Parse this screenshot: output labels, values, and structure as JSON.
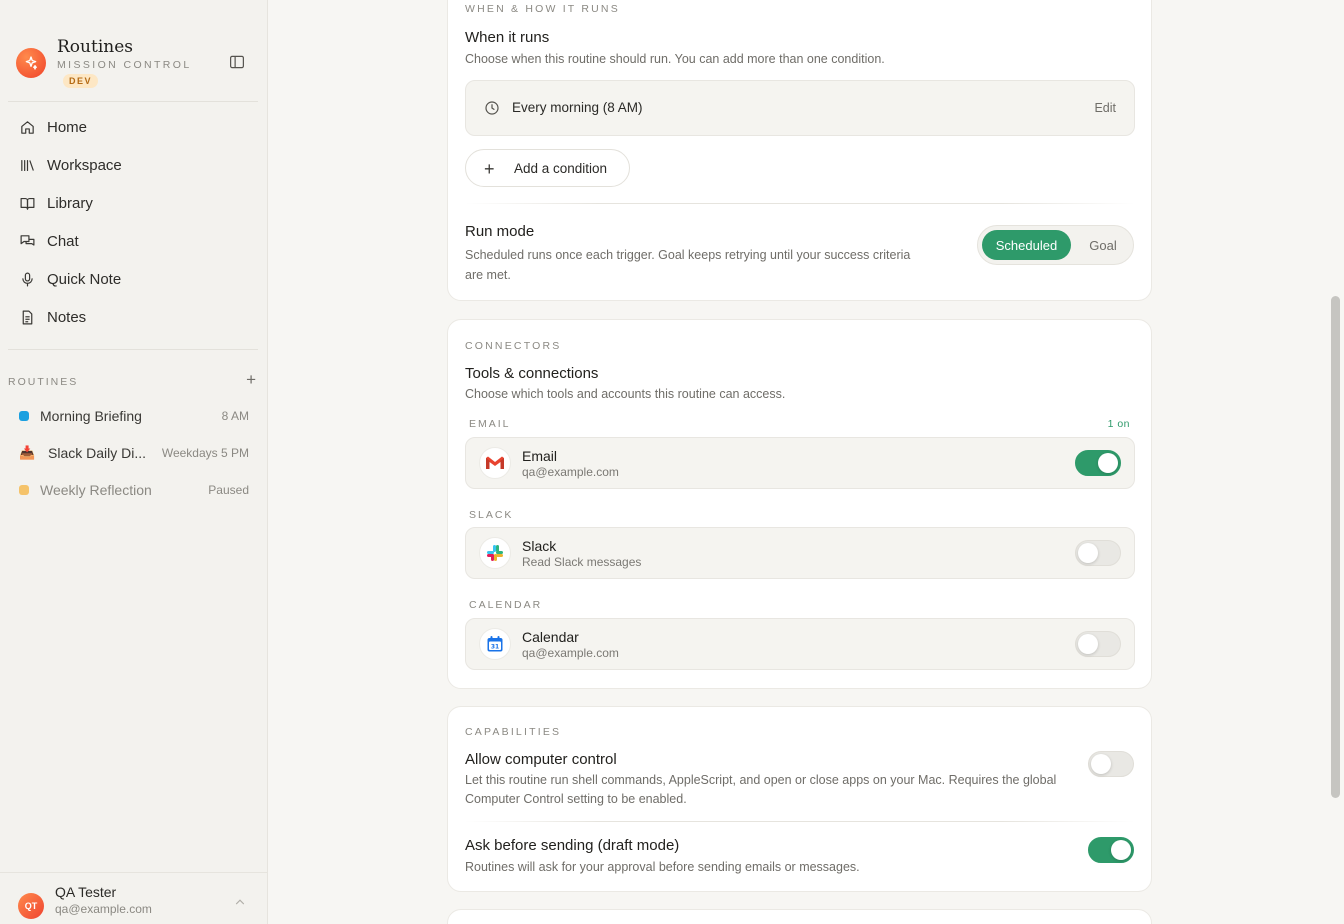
{
  "brand": {
    "title": "Routines",
    "subtitle": "MISSION CONTROL",
    "badge": "DEV"
  },
  "nav": [
    {
      "label": "Home",
      "icon": "home-icon"
    },
    {
      "label": "Workspace",
      "icon": "books-icon"
    },
    {
      "label": "Library",
      "icon": "book-open-icon"
    },
    {
      "label": "Chat",
      "icon": "chat-icon"
    },
    {
      "label": "Quick Note",
      "icon": "microphone-icon"
    },
    {
      "label": "Notes",
      "icon": "document-icon"
    }
  ],
  "routines": {
    "label": "ROUTINES",
    "add": "+",
    "items": [
      {
        "name": "Morning Briefing",
        "meta": "8 AM",
        "color": "#1aa0e0"
      },
      {
        "name": "Slack Daily Di...",
        "meta": "Weekdays 5 PM",
        "emoji": "📥"
      },
      {
        "name": "Weekly Reflection",
        "meta": "Paused",
        "color": "#f5c36a"
      }
    ]
  },
  "user": {
    "initials": "QT",
    "name": "QA Tester",
    "email": "qa@example.com"
  },
  "schedule": {
    "eyebrow": "WHEN & HOW IT RUNS",
    "title": "When it runs",
    "desc": "Choose when this routine should run. You can add more than one condition.",
    "condition": "Every morning (8 AM)",
    "edit": "Edit",
    "add_condition": "Add a condition",
    "run_mode_title": "Run mode",
    "run_mode_desc_1": "Scheduled runs once each trigger. Goal keeps retrying until your success criteria",
    "run_mode_desc_2": "are met.",
    "mode_scheduled": "Scheduled",
    "mode_goal": "Goal"
  },
  "connectors": {
    "eyebrow": "CONNECTORS",
    "title": "Tools & connections",
    "desc": "Choose which tools and accounts this routine can access.",
    "groups": [
      {
        "label": "EMAIL",
        "count": "1 on",
        "name": "Email",
        "sub": "qa@example.com",
        "on": true
      },
      {
        "label": "SLACK",
        "count": "",
        "name": "Slack",
        "sub": "Read Slack messages",
        "on": false
      },
      {
        "label": "CALENDAR",
        "count": "",
        "name": "Calendar",
        "sub": "qa@example.com",
        "on": false
      }
    ]
  },
  "capabilities": {
    "eyebrow": "CAPABILITIES",
    "computer_title": "Allow computer control",
    "computer_desc_1": "Let this routine run shell commands, AppleScript, and open or close apps on your Mac. Requires the global",
    "computer_desc_2": "Computer Control setting to be enabled.",
    "computer_on": false,
    "draft_title": "Ask before sending (draft mode)",
    "draft_desc": "Routines will ask for your approval before sending emails or messages.",
    "draft_on": true
  },
  "colors": {
    "accent": "#2e9a6a",
    "brand": "#f0432a"
  }
}
